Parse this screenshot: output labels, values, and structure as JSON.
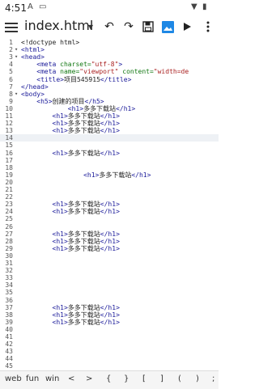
{
  "status": {
    "time": "4:51",
    "icons": [
      "a-notification-icon",
      "sim-card-icon"
    ]
  },
  "toolbar": {
    "title": "index.html",
    "dropdown": "▾",
    "icons": [
      "undo-icon",
      "redo-icon",
      "save-icon",
      "image-preview-icon",
      "run-icon",
      "overflow-menu-icon"
    ]
  },
  "editor": {
    "lines": [
      {
        "n": "1",
        "fold": "",
        "code": [
          {
            "t": "<!doctype html>",
            "c": "txt"
          }
        ]
      },
      {
        "n": "2",
        "fold": "▾",
        "code": [
          {
            "t": "<html>",
            "c": "tag"
          }
        ]
      },
      {
        "n": "3",
        "fold": "▾",
        "code": [
          {
            "t": "<head>",
            "c": "tag"
          }
        ]
      },
      {
        "n": "4",
        "fold": "",
        "code": [
          {
            "t": "    <meta ",
            "c": "tag"
          },
          {
            "t": "charset=",
            "c": "attr"
          },
          {
            "t": "\"utf-8\"",
            "c": "str"
          },
          {
            "t": ">",
            "c": "tag"
          }
        ]
      },
      {
        "n": "5",
        "fold": "",
        "code": [
          {
            "t": "    <meta ",
            "c": "tag"
          },
          {
            "t": "name=",
            "c": "attr"
          },
          {
            "t": "\"viewport\"",
            "c": "str"
          },
          {
            "t": " content=",
            "c": "attr"
          },
          {
            "t": "\"width=de",
            "c": "str"
          }
        ]
      },
      {
        "n": "6",
        "fold": "",
        "code": [
          {
            "t": "    <title>",
            "c": "tag"
          },
          {
            "t": "项目545915",
            "c": "txt"
          },
          {
            "t": "</title>",
            "c": "tag"
          }
        ]
      },
      {
        "n": "7",
        "fold": "",
        "code": [
          {
            "t": "</head>",
            "c": "tag"
          }
        ]
      },
      {
        "n": "8",
        "fold": "▾",
        "code": [
          {
            "t": "<body>",
            "c": "tag"
          }
        ]
      },
      {
        "n": "9",
        "fold": "",
        "code": [
          {
            "t": "    <h5>",
            "c": "tag"
          },
          {
            "t": "创建的项目",
            "c": "txt"
          },
          {
            "t": "</h5>",
            "c": "tag"
          }
        ]
      },
      {
        "n": "10",
        "fold": "",
        "code": [
          {
            "t": "            <h1>",
            "c": "tag"
          },
          {
            "t": "多多下载站",
            "c": "txt"
          },
          {
            "t": "</h1>",
            "c": "tag"
          }
        ]
      },
      {
        "n": "11",
        "fold": "",
        "code": [
          {
            "t": "        <h1>",
            "c": "tag"
          },
          {
            "t": "多多下载站",
            "c": "txt"
          },
          {
            "t": "</h1>",
            "c": "tag"
          }
        ]
      },
      {
        "n": "12",
        "fold": "",
        "code": [
          {
            "t": "        <h1>",
            "c": "tag"
          },
          {
            "t": "多多下载站",
            "c": "txt"
          },
          {
            "t": "</h1>",
            "c": "tag"
          }
        ]
      },
      {
        "n": "13",
        "fold": "",
        "code": [
          {
            "t": "        <h1>",
            "c": "tag"
          },
          {
            "t": "多多下载站",
            "c": "txt"
          },
          {
            "t": "</h1>",
            "c": "tag"
          }
        ]
      },
      {
        "n": "14",
        "fold": "",
        "code": [],
        "current": true
      },
      {
        "n": "15",
        "fold": "",
        "code": []
      },
      {
        "n": "16",
        "fold": "",
        "code": [
          {
            "t": "        <h1>",
            "c": "tag"
          },
          {
            "t": "多多下载站",
            "c": "txt"
          },
          {
            "t": "</h1>",
            "c": "tag"
          }
        ]
      },
      {
        "n": "17",
        "fold": "",
        "code": []
      },
      {
        "n": "18",
        "fold": "",
        "code": []
      },
      {
        "n": "19",
        "fold": "",
        "code": [
          {
            "t": "                <h1>",
            "c": "tag"
          },
          {
            "t": "多多下载站",
            "c": "txt"
          },
          {
            "t": "</h1>",
            "c": "tag"
          }
        ]
      },
      {
        "n": "20",
        "fold": "",
        "code": []
      },
      {
        "n": "21",
        "fold": "",
        "code": []
      },
      {
        "n": "22",
        "fold": "",
        "code": []
      },
      {
        "n": "23",
        "fold": "",
        "code": [
          {
            "t": "        <h1>",
            "c": "tag"
          },
          {
            "t": "多多下载站",
            "c": "txt"
          },
          {
            "t": "</h1>",
            "c": "tag"
          }
        ]
      },
      {
        "n": "24",
        "fold": "",
        "code": [
          {
            "t": "        <h1>",
            "c": "tag"
          },
          {
            "t": "多多下载站",
            "c": "txt"
          },
          {
            "t": "</h1>",
            "c": "tag"
          }
        ]
      },
      {
        "n": "25",
        "fold": "",
        "code": []
      },
      {
        "n": "26",
        "fold": "",
        "code": []
      },
      {
        "n": "27",
        "fold": "",
        "code": [
          {
            "t": "        <h1>",
            "c": "tag"
          },
          {
            "t": "多多下载站",
            "c": "txt"
          },
          {
            "t": "</h1>",
            "c": "tag"
          }
        ]
      },
      {
        "n": "28",
        "fold": "",
        "code": [
          {
            "t": "        <h1>",
            "c": "tag"
          },
          {
            "t": "多多下载站",
            "c": "txt"
          },
          {
            "t": "</h1>",
            "c": "tag"
          }
        ]
      },
      {
        "n": "29",
        "fold": "",
        "code": [
          {
            "t": "        <h1>",
            "c": "tag"
          },
          {
            "t": "多多下载站",
            "c": "txt"
          },
          {
            "t": "</h1>",
            "c": "tag"
          }
        ]
      },
      {
        "n": "30",
        "fold": "",
        "code": []
      },
      {
        "n": "31",
        "fold": "",
        "code": []
      },
      {
        "n": "32",
        "fold": "",
        "code": []
      },
      {
        "n": "33",
        "fold": "",
        "code": []
      },
      {
        "n": "34",
        "fold": "",
        "code": []
      },
      {
        "n": "35",
        "fold": "",
        "code": []
      },
      {
        "n": "36",
        "fold": "",
        "code": []
      },
      {
        "n": "37",
        "fold": "",
        "code": [
          {
            "t": "        <h1>",
            "c": "tag"
          },
          {
            "t": "多多下载站",
            "c": "txt"
          },
          {
            "t": "</h1>",
            "c": "tag"
          }
        ]
      },
      {
        "n": "38",
        "fold": "",
        "code": [
          {
            "t": "        <h1>",
            "c": "tag"
          },
          {
            "t": "多多下载站",
            "c": "txt"
          },
          {
            "t": "</h1>",
            "c": "tag"
          }
        ]
      },
      {
        "n": "39",
        "fold": "",
        "code": [
          {
            "t": "        <h1>",
            "c": "tag"
          },
          {
            "t": "多多下载站",
            "c": "txt"
          },
          {
            "t": "</h1>",
            "c": "tag"
          }
        ]
      },
      {
        "n": "40",
        "fold": "",
        "code": []
      },
      {
        "n": "41",
        "fold": "",
        "code": []
      },
      {
        "n": "42",
        "fold": "",
        "code": []
      },
      {
        "n": "43",
        "fold": "",
        "code": []
      },
      {
        "n": "44",
        "fold": "",
        "code": []
      },
      {
        "n": "45",
        "fold": "",
        "code": []
      }
    ]
  },
  "shortcuts": [
    "web",
    "fun",
    "win",
    "<",
    ">",
    "{",
    "}",
    "[",
    "]",
    "(",
    ")",
    ";"
  ]
}
